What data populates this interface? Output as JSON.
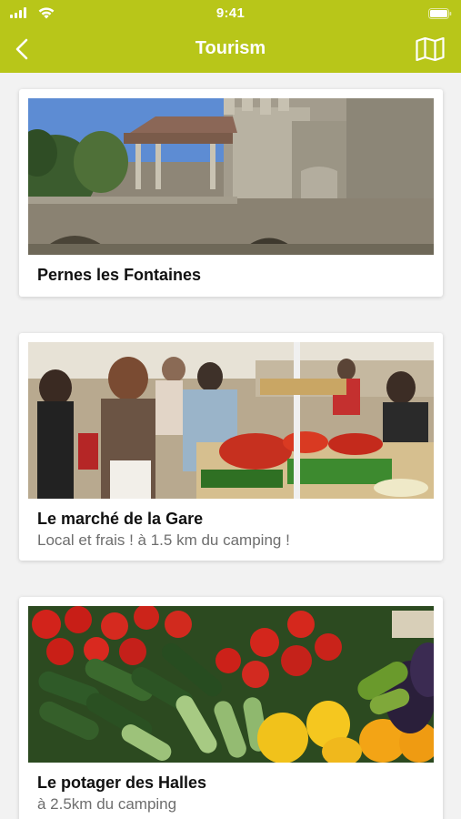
{
  "status_bar": {
    "time": "9:41"
  },
  "header": {
    "title": "Tourism",
    "background": "#b8c619"
  },
  "items": [
    {
      "title": "Pernes les Fontaines",
      "subtitle": ""
    },
    {
      "title": "Le marché de la Gare",
      "subtitle": "Local et frais ! à 1.5 km du camping !"
    },
    {
      "title": "Le potager des Halles",
      "subtitle": "à 2.5km du camping"
    }
  ]
}
